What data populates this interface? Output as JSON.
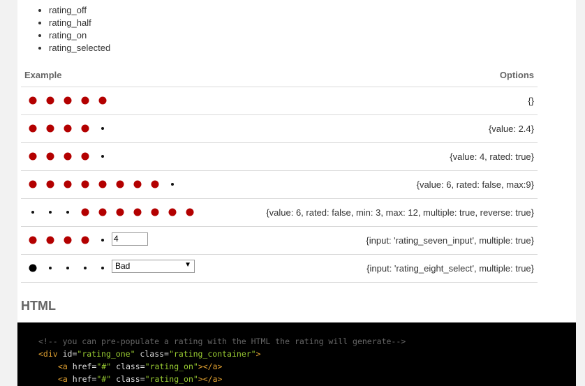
{
  "class_list": [
    "rating_off",
    "rating_half",
    "rating_on",
    "rating_selected"
  ],
  "table": {
    "header_example": "Example",
    "header_options": "Options",
    "rows": [
      {
        "options": "{}",
        "dots": [
          "on",
          "on",
          "on",
          "on",
          "on"
        ]
      },
      {
        "options": "{value: 2.4}",
        "dots": [
          "on",
          "on",
          "on",
          "on",
          "off"
        ]
      },
      {
        "options": "{value: 4, rated: true}",
        "dots": [
          "on",
          "on",
          "on",
          "on",
          "off"
        ]
      },
      {
        "options": "{value: 6, rated: false, max:9}",
        "dots": [
          "on",
          "on",
          "on",
          "on",
          "on",
          "on",
          "on",
          "on",
          "off"
        ]
      },
      {
        "options": "{value: 6, rated: false, min: 3, max: 12, multiple: true, reverse: true}",
        "dots": [
          "off",
          "off",
          "off",
          "on",
          "on",
          "on",
          "on",
          "on",
          "on",
          "on"
        ]
      },
      {
        "options": "{input: 'rating_seven_input', multiple: true}",
        "dots": [
          "on",
          "on",
          "on",
          "on",
          "off"
        ],
        "input_value": "4"
      },
      {
        "options": "{input: 'rating_eight_select', multiple: true}",
        "dots": [
          "big",
          "off",
          "off",
          "off",
          "off"
        ],
        "select_value": "Bad"
      }
    ]
  },
  "html_heading": "HTML",
  "code": {
    "comment": "<!-- you can pre-populate a rating with the HTML the rating will generate-->",
    "div_open": "<div",
    "div_id_attr": " id=",
    "div_id_val": "\"rating_one\"",
    "div_class_attr": " class=",
    "div_class_val": "\"rating_container\"",
    "div_close": ">",
    "a_open": "<a",
    "a_href_attr": " href=",
    "a_href_val": "\"#\"",
    "a_class_attr": " class=",
    "a_class_val": "\"rating_on\"",
    "a_close": "></a>"
  },
  "colors": {
    "rating_on": "#b30000",
    "rating_off": "#111111",
    "code_bg": "#000000"
  }
}
